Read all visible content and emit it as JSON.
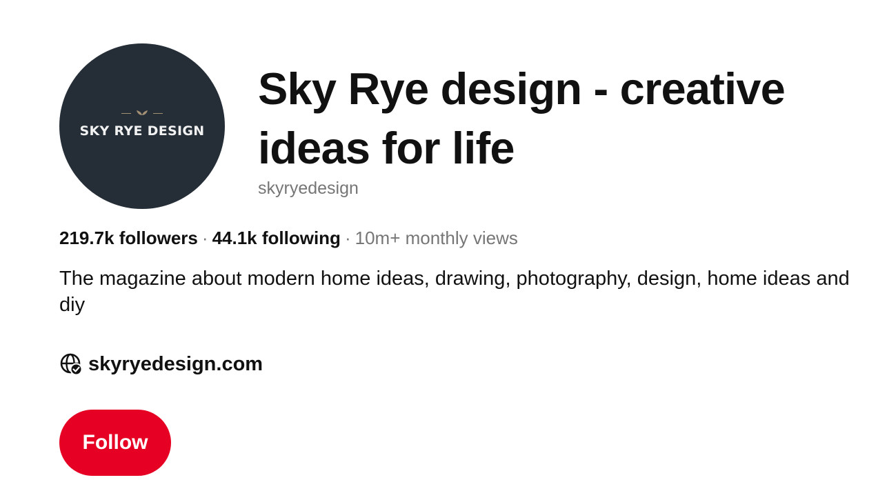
{
  "profile": {
    "avatar": {
      "logo_text": "SKY RYE DESIGN",
      "background_color": "#252e37",
      "ornament_color": "#a38f74",
      "icon": "leaf-ornament-icon"
    },
    "title": "Sky Rye design - creative ideas for life",
    "username": "skyryedesign"
  },
  "stats": {
    "followers": "219.7k followers",
    "separator": "·",
    "following": "44.1k following",
    "monthly_views": "10m+ monthly views"
  },
  "description": "The magazine about modern home ideas, drawing, photography, design, home ideas and diy",
  "website": {
    "icon": "verified-globe-icon",
    "label": "skyryedesign.com"
  },
  "actions": {
    "follow_label": "Follow",
    "follow_color": "#e60023"
  }
}
